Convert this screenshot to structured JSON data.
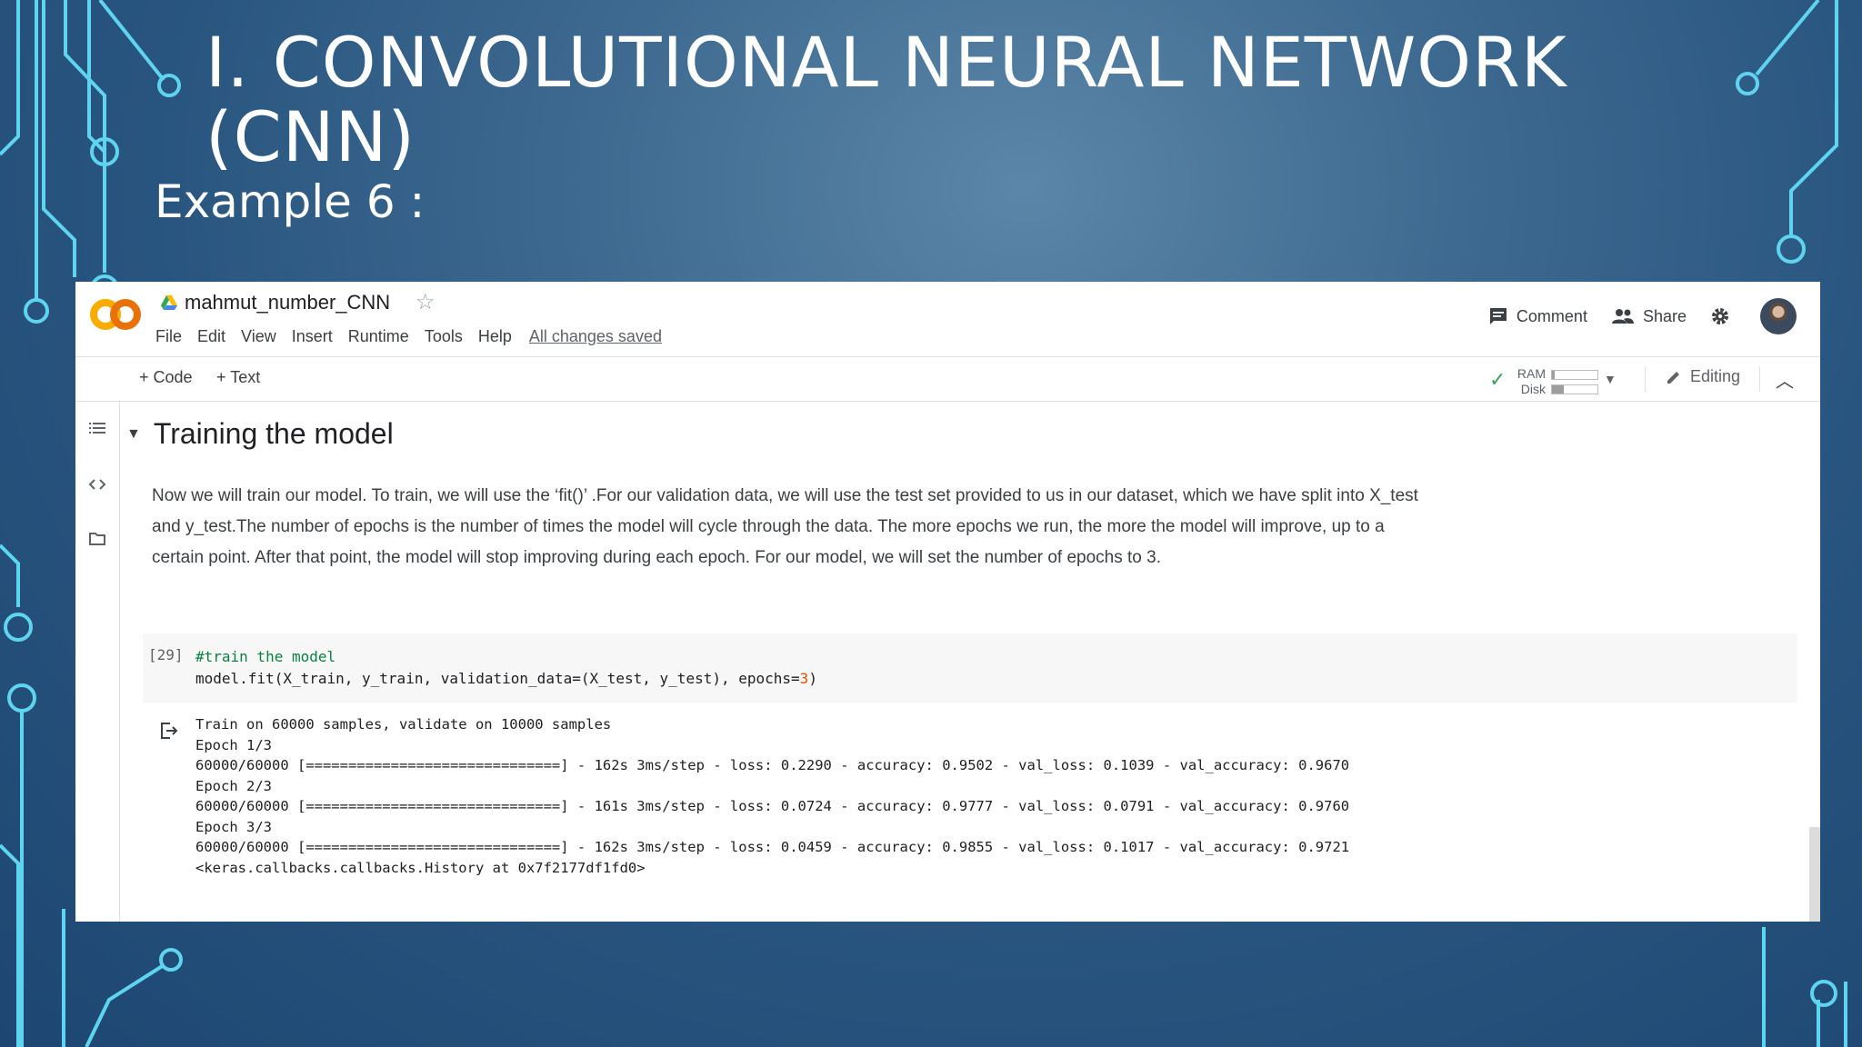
{
  "slide": {
    "title_line1": "I. CONVOLUTIONAL NEURAL NETWORK",
    "title_line2": "(CNN)",
    "subtitle": "Example 6 :"
  },
  "colab": {
    "logo_text": "CO",
    "notebook_name": "mahmut_number_CNN",
    "menu": [
      "File",
      "Edit",
      "View",
      "Insert",
      "Runtime",
      "Tools",
      "Help"
    ],
    "save_status": "All changes saved",
    "comment_label": "Comment",
    "share_label": "Share",
    "add_code_label": "+ Code",
    "add_text_label": "+ Text",
    "ram_label": "RAM",
    "disk_label": "Disk",
    "ram_fraction": 0.06,
    "disk_fraction": 0.25,
    "editing_label": "Editing",
    "section_title": "Training the model",
    "paragraph": "Now we will train our model. To train, we will use the ‘fit()’ .For our validation data, we will use the test set provided to us in our dataset, which we have split into X_test and y_test.The number of epochs is the number of times the model will cycle through the data. The more epochs we run, the more the model will improve, up to a certain point. After that point, the model will stop improving during each epoch. For our model, we will set the number of epochs to 3.",
    "cell_exec_count": "[29]",
    "code_comment": "#train the model",
    "code_line_prefix": "model.fit(X_train, y_train, validation_data=(X_test, y_test), epochs=",
    "code_epochs_value": "3",
    "code_line_suffix": ")",
    "output_lines": [
      "Train on 60000 samples, validate on 10000 samples",
      "Epoch 1/3",
      "60000/60000 [==============================] - 162s 3ms/step - loss: 0.2290 - accuracy: 0.9502 - val_loss: 0.1039 - val_accuracy: 0.9670",
      "Epoch 2/3",
      "60000/60000 [==============================] - 161s 3ms/step - loss: 0.0724 - accuracy: 0.9777 - val_loss: 0.0791 - val_accuracy: 0.9760",
      "Epoch 3/3",
      "60000/60000 [==============================] - 162s 3ms/step - loss: 0.0459 - accuracy: 0.9855 - val_loss: 0.1017 - val_accuracy: 0.9721",
      "<keras.callbacks.callbacks.History at 0x7f2177df1fd0>"
    ]
  }
}
